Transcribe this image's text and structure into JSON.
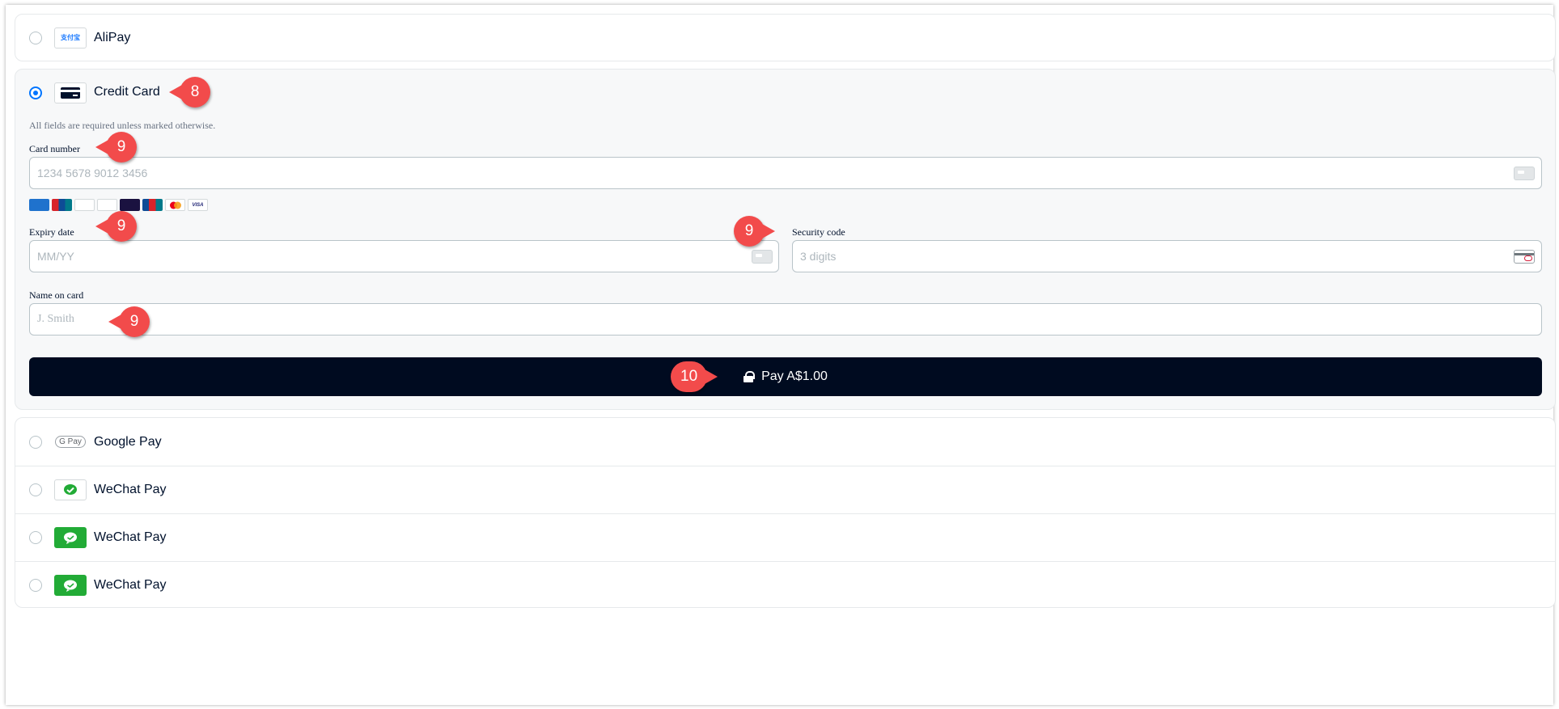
{
  "alipay": {
    "label": "AliPay",
    "logo_text": "支付宝"
  },
  "credit_card": {
    "label": "Credit Card",
    "note": "All fields are required unless marked otherwise.",
    "card_number": {
      "label": "Card number",
      "placeholder": "1234 5678 9012 3456"
    },
    "brands": [
      "AMEX",
      "UnionPay",
      "Diners",
      "DISCOVER",
      "Elo",
      "JCB",
      "Mastercard",
      "VISA"
    ],
    "expiry": {
      "label": "Expiry date",
      "placeholder": "MM/YY"
    },
    "security": {
      "label": "Security code",
      "placeholder": "3 digits"
    },
    "name": {
      "label": "Name on card",
      "placeholder": "J. Smith"
    },
    "pay_button": "Pay A$1.00"
  },
  "others": [
    {
      "label": "Google Pay",
      "logo": "G Pay"
    },
    {
      "label": "WeChat Pay"
    },
    {
      "label": "WeChat Pay"
    },
    {
      "label": "WeChat Pay"
    }
  ],
  "annotations": {
    "credit_card": "8",
    "field": "9",
    "pay": "10"
  },
  "colors": {
    "accent": "#0075ff",
    "button": "#000b20",
    "badge": "#f24b4b",
    "wechat": "#22ab36"
  }
}
